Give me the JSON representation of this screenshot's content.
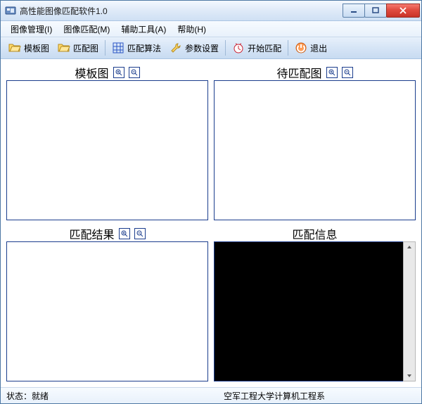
{
  "window": {
    "title": "高性能图像匹配软件1.0"
  },
  "menu": {
    "image_manage": "图像管理(I)",
    "image_match": "图像匹配(M)",
    "aux_tools": "辅助工具(A)",
    "help": "帮助(H)"
  },
  "toolbar": {
    "template": "模板图",
    "matchimg": "匹配图",
    "algorithm": "匹配算法",
    "params": "参数设置",
    "start": "开始匹配",
    "exit": "退出"
  },
  "panels": {
    "template": {
      "title": "模板图"
    },
    "pending": {
      "title": "待匹配图"
    },
    "result": {
      "title": "匹配结果"
    },
    "info": {
      "title": "匹配信息"
    }
  },
  "status": {
    "left": "状态：就绪",
    "center": "空军工程大学计算机工程系"
  },
  "colors": {
    "border": "#1b3d8d",
    "toolbar_grad_top": "#e7f0fb",
    "close": "#e04b3f"
  }
}
